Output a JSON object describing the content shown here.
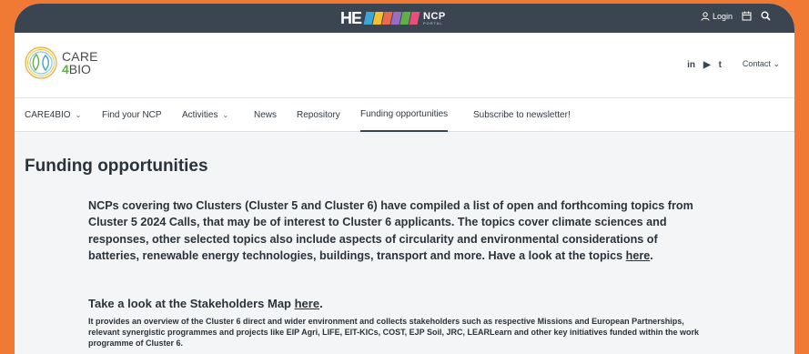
{
  "topbar": {
    "logo_text": "NCP",
    "logo_sub": "PORTAL",
    "he_mark": "HE",
    "login_label": "Login"
  },
  "header": {
    "brand_line1": "CARE",
    "brand_four": "4",
    "brand_bio": "BIO",
    "social": [
      "in",
      "▶",
      "t"
    ],
    "contact_label": "Contact"
  },
  "nav": {
    "items": [
      {
        "label": "CARE4BIO",
        "has_dropdown": true
      },
      {
        "label": "Find your NCP",
        "has_dropdown": false
      },
      {
        "label": "Activities",
        "has_dropdown": true
      },
      {
        "label": "News",
        "has_dropdown": false
      },
      {
        "label": "Repository",
        "has_dropdown": false
      },
      {
        "label": "Funding opportunities",
        "has_dropdown": false,
        "active": true
      },
      {
        "label": "Subscribe to newsletter!",
        "has_dropdown": false
      }
    ]
  },
  "content": {
    "page_title": "Funding opportunities",
    "para1_text": "NCPs covering two Clusters (Cluster 5 and Cluster 6) have compiled a list of open and forthcoming topics from Cluster 5 2024 Calls, that may be of interest to Cluster 6 applicants. The topics cover climate sciences and responses, other selected topics also include aspects of circularity and environmental considerations of batteries, renewable energy technologies, buildings, transport and more. Have a look at the topics ",
    "para1_link": "here",
    "para1_end": ".",
    "sub_head_text": "Take a look at the Stakeholders Map ",
    "sub_head_link": "here",
    "sub_head_end": ".",
    "para2_text": "It provides an overview of the Cluster 6 direct and wider environment and collects stakeholders such as respective Missions and European Partnerships, relevant synergistic programmes and projects like EIP Agri, LIFE, EIT-KICs, COST, EJP Soil, JRC, LEARLearn and other key initiatives funded within the work programme of Cluster 6."
  },
  "colors": {
    "background_orange": "#f07a34",
    "topbar": "#3b4551",
    "page_bg": "#f4f5f6",
    "text": "#2a323b",
    "brand_green": "#5fb04a"
  }
}
